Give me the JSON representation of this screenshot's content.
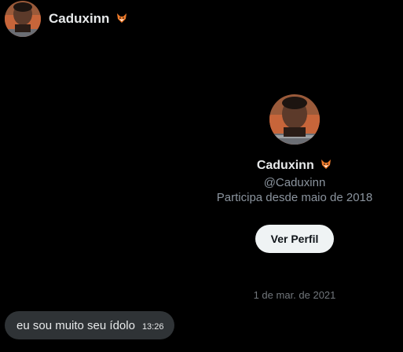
{
  "header": {
    "name": "Caduxinn",
    "avatar_icon": "user-avatar",
    "badge_icon": "fox-emoji-icon"
  },
  "profile": {
    "name": "Caduxinn",
    "handle": "@Caduxinn",
    "since": "Participa desde maio de 2018",
    "view_button": "Ver Perfil",
    "avatar_icon": "user-avatar"
  },
  "conversation": {
    "date_separator": "1 de mar. de 2021",
    "messages": [
      {
        "text": "eu sou muito seu ídolo",
        "time": "13:26"
      }
    ]
  },
  "colors": {
    "background": "#000000",
    "text": "#e7e9ea",
    "muted": "#71767b",
    "bubble": "#2f3336",
    "button_bg": "#eff3f4"
  }
}
